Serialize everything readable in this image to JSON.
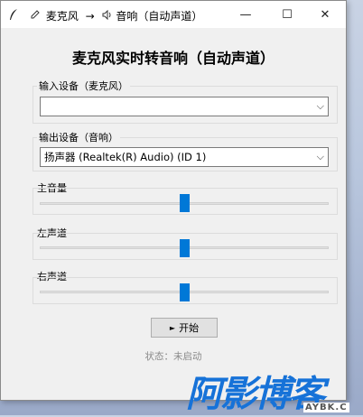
{
  "titlebar": {
    "title_mic": "麦克风",
    "arrow": "→",
    "title_out": "音响（自动声道）",
    "minimize": "—",
    "maximize": "☐",
    "close": "✕"
  },
  "heading": "麦克风实时转音响（自动声道）",
  "input_group": {
    "label": "输入设备（麦克风）",
    "value": "",
    "chevron": "⌵"
  },
  "output_group": {
    "label": "输出设备（音响）",
    "value": "扬声器 (Realtek(R) Audio) (ID 1)",
    "chevron": "⌵"
  },
  "sliders": [
    {
      "label": "主音量",
      "level": 0.5
    },
    {
      "label": "左声道",
      "level": 0.5
    },
    {
      "label": "右声道",
      "level": 0.5
    }
  ],
  "start_button": {
    "icon": "►",
    "label": "开始"
  },
  "status": "状态：未启动",
  "watermark": {
    "big": "阿影博客",
    "small": "AYBK.C"
  },
  "colors": {
    "accent": "#0078d7",
    "watermark": "#1672d8"
  }
}
